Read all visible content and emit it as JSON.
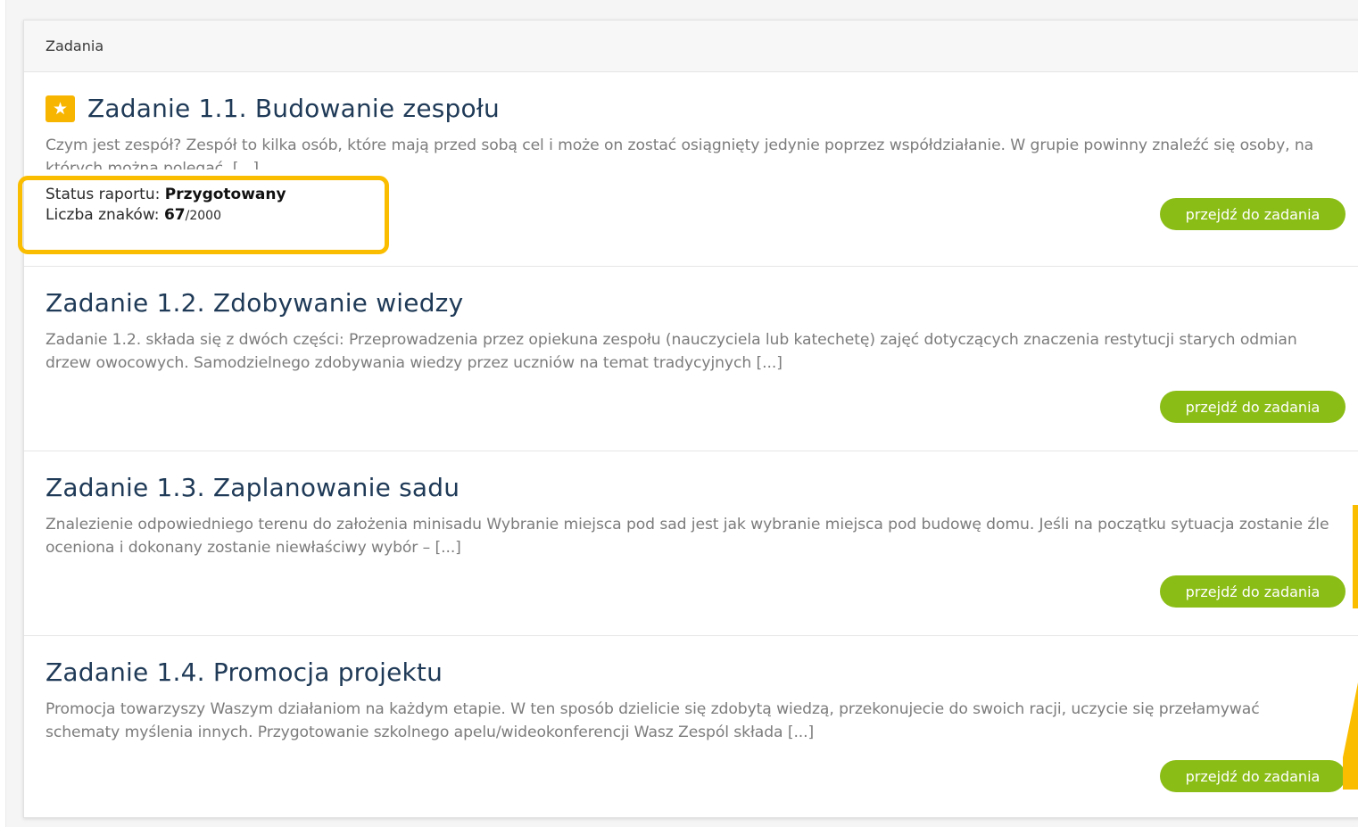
{
  "panel": {
    "header_title": "Zadania"
  },
  "tasks": [
    {
      "title": "Zadanie 1.1. Budowanie zespołu",
      "starred": true,
      "description": "Czym jest zespół? Zespół to kilka osób, które mają przed sobą cel i może on zostać osiągnięty jedynie poprzez współdziałanie. W grupie powinny znaleźć się osoby, na których można polegać. [...]",
      "status_label": "Status raportu:",
      "status_value": "Przygotowany",
      "chars_label": "Liczba znaków:",
      "chars_value": "67",
      "chars_limit": "/2000",
      "button_label": "przejdź do zadania"
    },
    {
      "title": "Zadanie 1.2. Zdobywanie wiedzy",
      "description": "Zadanie 1.2. składa się z dwóch części: Przeprowadzenia przez opiekuna zespołu (nauczyciela lub katechetę) zajęć dotyczących znaczenia restytucji starych odmian drzew owocowych. Samodzielnego zdobywania wiedzy przez uczniów na temat tradycyjnych [...]",
      "button_label": "przejdź do zadania"
    },
    {
      "title": "Zadanie 1.3. Zaplanowanie sadu",
      "description": "Znalezienie odpowiedniego terenu do założenia minisadu Wybranie miejsca pod sad jest jak wybranie miejsca pod budowę domu. Jeśli na początku sytuacja zostanie źle oceniona i dokonany zostanie niewłaściwy wybór – [...]",
      "button_label": "przejdź do zadania"
    },
    {
      "title": "Zadanie 1.4. Promocja projektu",
      "description": "Promocja towarzyszy Waszym działaniom na każdym etapie. W ten sposób dzielicie się zdobytą wiedzą, przekonujecie do swoich racji, uczycie się przełamywać schematy myślenia innych. Przygotowanie szkolnego apelu/wideokonferencji Wasz Zespól składa [...]",
      "button_label": "przejdź do zadania"
    }
  ],
  "icons": {
    "star": "star-icon"
  },
  "colors": {
    "button_green": "#8bbd17",
    "highlight_yellow": "#fbbd00",
    "star_badge": "#f7b500",
    "title_navy": "#1f3a57"
  }
}
